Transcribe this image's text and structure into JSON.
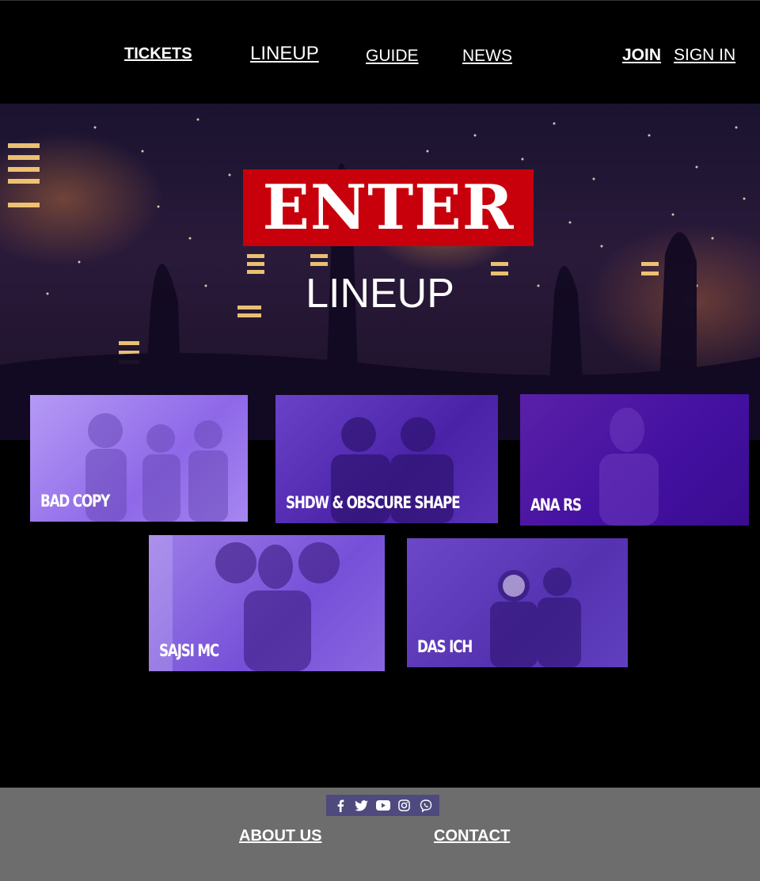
{
  "nav": {
    "tickets": "TICKETS",
    "lineup": "LINEUP",
    "guide": "GUIDE",
    "news": "NEWS",
    "join": "JOIN",
    "sign_in": "SIGN IN"
  },
  "hero": {
    "logo_text": "ENTER",
    "title": "LINEUP"
  },
  "lineup": [
    {
      "name": "BAD COPY"
    },
    {
      "name": "SHDW & OBSCURE SHAPE"
    },
    {
      "name": "ANA RS"
    },
    {
      "name": "SAJSI MC"
    },
    {
      "name": "DAS ICH"
    }
  ],
  "footer": {
    "social_icons": [
      "facebook-icon",
      "twitter-icon",
      "youtube-icon",
      "instagram-icon",
      "viber-icon"
    ],
    "about_us": "ABOUT US",
    "contact": "CONTACT"
  },
  "colors": {
    "logo_red": "#c8000b",
    "footer_gray": "#6d6d6d",
    "social_bar": "#4e4a7e",
    "card_purple": "#5a32b8"
  }
}
